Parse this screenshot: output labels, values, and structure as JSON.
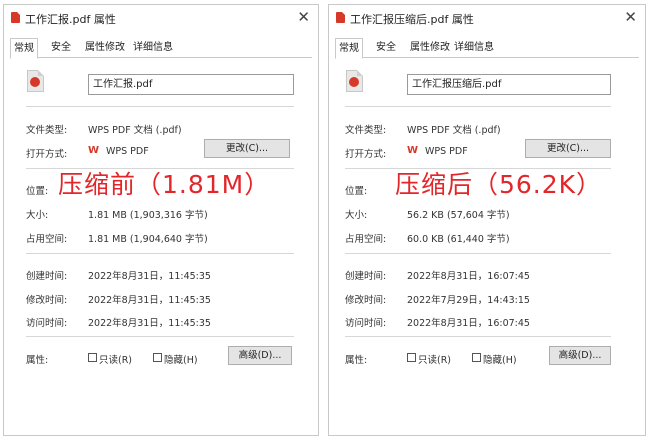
{
  "left": {
    "title": "工作汇报.pdf 属性",
    "tabs": [
      "常规",
      "安全",
      "属性修改",
      "详细信息"
    ],
    "filename": "工作汇报.pdf",
    "file_type_label": "文件类型:",
    "file_type_value": "WPS PDF 文档 (.pdf)",
    "open_with_label": "打开方式:",
    "open_with_value": "WPS PDF",
    "change_button": "更改(C)...",
    "location_label": "位置:",
    "size_label": "大小:",
    "size_value": "1.81 MB (1,903,316 字节)",
    "disk_label": "占用空间:",
    "disk_value": "1.81 MB (1,904,640 字节)",
    "created_label": "创建时间:",
    "created_value": "2022年8月31日，11:45:35",
    "modified_label": "修改时间:",
    "modified_value": "2022年8月31日，11:45:35",
    "accessed_label": "访问时间:",
    "accessed_value": "2022年8月31日，11:45:35",
    "attr_label": "属性:",
    "readonly_label": "只读(R)",
    "hidden_label": "隐藏(H)",
    "advanced_button": "高级(D)...",
    "overlay": "压缩前（1.81M）"
  },
  "right": {
    "title": "工作汇报压缩后.pdf 属性",
    "tabs": [
      "常规",
      "安全",
      "属性修改",
      "详细信息"
    ],
    "filename": "工作汇报压缩后.pdf",
    "file_type_label": "文件类型:",
    "file_type_value": "WPS PDF 文档 (.pdf)",
    "open_with_label": "打开方式:",
    "open_with_value": "WPS PDF",
    "change_button": "更改(C)...",
    "location_label": "位置:",
    "size_label": "大小:",
    "size_value": "56.2 KB (57,604 字节)",
    "disk_label": "占用空间:",
    "disk_value": "60.0 KB (61,440 字节)",
    "created_label": "创建时间:",
    "created_value": "2022年8月31日，16:07:45",
    "modified_label": "修改时间:",
    "modified_value": "2022年7月29日，14:43:15",
    "accessed_label": "访问时间:",
    "accessed_value": "2022年8月31日，16:07:45",
    "attr_label": "属性:",
    "readonly_label": "只读(R)",
    "hidden_label": "隐藏(H)",
    "advanced_button": "高级(D)...",
    "overlay": "压缩后（56.2K）"
  },
  "colors": {
    "accent_red": "#e3262a",
    "pdf_red": "#d6392a"
  },
  "icons": [
    "pdf-file-icon",
    "wps-logo-icon",
    "close-icon",
    "checkbox"
  ]
}
